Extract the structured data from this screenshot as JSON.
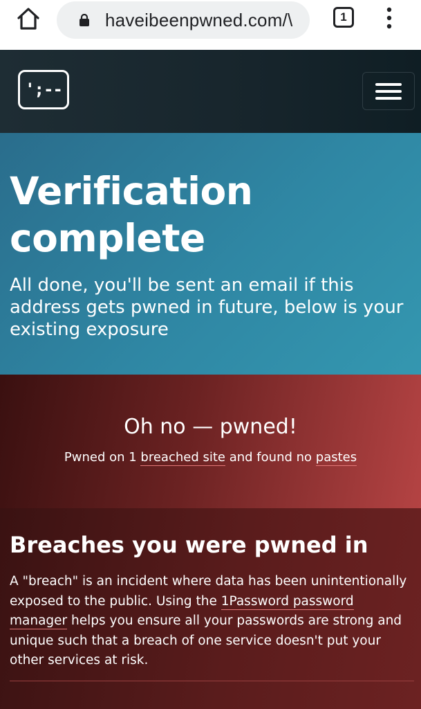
{
  "browser": {
    "url": "haveibeenpwned.com/\\",
    "tab_count": "1"
  },
  "nav": {
    "logo_text": "';--"
  },
  "hero": {
    "title": "Verification complete",
    "message": "All done, you'll be sent an email if this address gets pwned in future, below is your existing exposure"
  },
  "pwned": {
    "headline": "Oh no — pwned!",
    "sub_prefix": "Pwned on 1 ",
    "breached_link": "breached site",
    "sub_middle": " and found no ",
    "pastes_link": "pastes"
  },
  "breaches": {
    "title": "Breaches you were pwned in",
    "desc_before": "A \"breach\" is an incident where data has been unintentionally exposed to the public. Using the ",
    "manager_link": "1Password password manager",
    "desc_after": " helps you ensure all your passwords are strong and unique such that a breach of one service doesn't put your other services at risk."
  },
  "colors": {
    "hero_bg": "#2f87a4",
    "pwned_bg": "#8a2a2a",
    "nav_bg": "#17252c",
    "link_underline": "#e37878"
  },
  "icons": [
    "home-icon",
    "lock-icon",
    "tab-switcher-icon",
    "more-vert-icon",
    "hamburger-icon"
  ]
}
